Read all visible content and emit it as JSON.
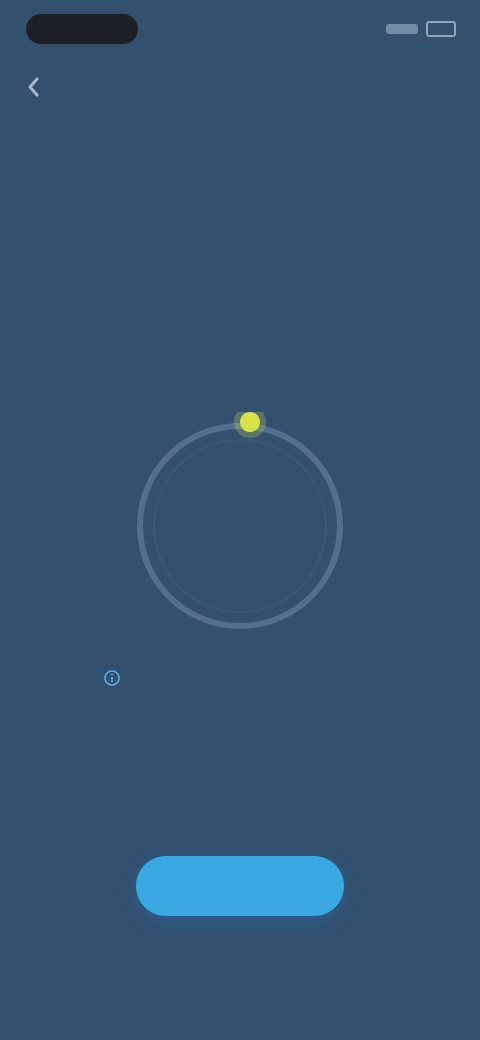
{
  "status_bar": {
    "time": "",
    "right_text": ""
  },
  "header": {
    "back_icon": "chevron-left-icon"
  },
  "main": {
    "title": "",
    "subtitle": "",
    "label": "",
    "gauge": {
      "value": "",
      "unit": "",
      "accent_color": "#d8e24a"
    },
    "info_link": ""
  },
  "footer": {
    "primary_button": "",
    "secondary_link": ""
  },
  "colors": {
    "background": "#34506f",
    "primary": "#3aa8e3",
    "link": "#5fa9e8"
  }
}
